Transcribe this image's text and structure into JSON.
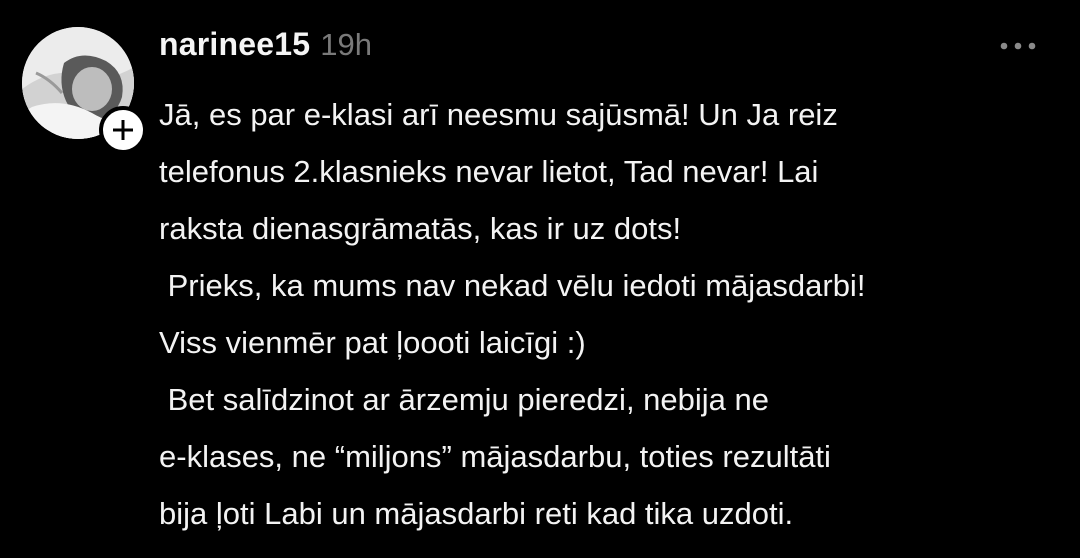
{
  "post": {
    "author": {
      "username": "narinee15",
      "avatar_icon": "profile-photo",
      "follow_icon": "plus-icon"
    },
    "timestamp": "19h",
    "more_icon": "ellipsis-icon",
    "lines": [
      "Jā, es par e-klasi arī neesmu sajūsmā! Un Ja reiz",
      "telefonus 2.klasnieks nevar lietot, Tad nevar! Lai",
      "raksta dienasgrāmatās, kas ir uz dots!",
      " Prieks, ka mums nav nekad vēlu iedoti mājasdarbi!",
      "Viss vienmēr pat ļoooti laicīgi :)",
      " Bet salīdzinot ar ārzemju pieredzi, nebija ne",
      "e-klases, ne “miljons” mājasdarbu, toties rezultāti",
      "bija ļoti Labi un mājasdarbi reti kad tika uzdoti."
    ]
  },
  "colors": {
    "background": "#000000",
    "text": "#f3f3f3",
    "muted": "#7a7a7a"
  }
}
